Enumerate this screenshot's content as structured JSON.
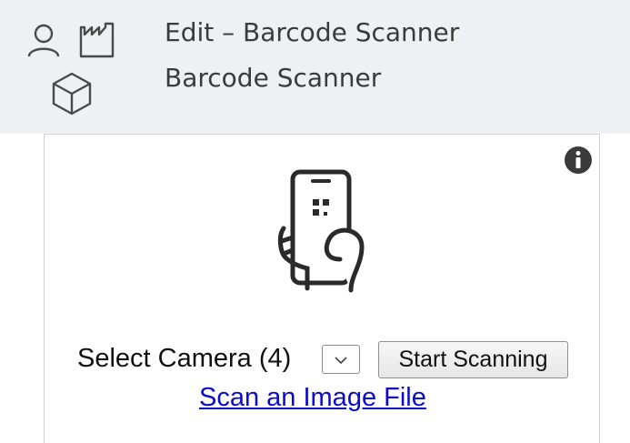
{
  "header": {
    "title": "Edit – Barcode Scanner",
    "subtitle": "Barcode Scanner",
    "icons": [
      "user-icon",
      "factory-icon",
      "cube-icon"
    ]
  },
  "scanner": {
    "info_icon": "info-icon",
    "illustration_icon": "phone-qr-scan-icon",
    "select_camera_label": "Select Camera (4)",
    "camera_select_icon": "chevron-down-icon",
    "start_button_label": "Start Scanning",
    "scan_file_link": "Scan an Image File"
  },
  "colors": {
    "header_bg": "#eef0f4",
    "link": "#0b0bd0",
    "text": "#111111"
  }
}
